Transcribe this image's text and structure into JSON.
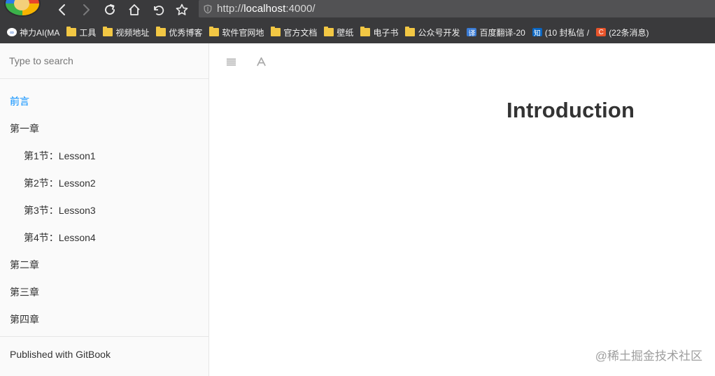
{
  "browser": {
    "url_prefix": "http://",
    "url_host": "localhost",
    "url_suffix": ":4000/",
    "bookmarks": [
      {
        "label": "神力AI(MA",
        "icon": "shenli-icon",
        "type": "site"
      },
      {
        "label": "工具",
        "icon": "folder-icon",
        "type": "folder"
      },
      {
        "label": "视频地址",
        "icon": "folder-icon",
        "type": "folder"
      },
      {
        "label": "优秀博客",
        "icon": "folder-icon",
        "type": "folder"
      },
      {
        "label": "软件官网地",
        "icon": "folder-icon",
        "type": "folder"
      },
      {
        "label": "官方文档",
        "icon": "folder-icon",
        "type": "folder"
      },
      {
        "label": "壁纸",
        "icon": "folder-icon",
        "type": "folder"
      },
      {
        "label": "电子书",
        "icon": "folder-icon",
        "type": "folder"
      },
      {
        "label": "公众号开发",
        "icon": "folder-icon",
        "type": "folder"
      },
      {
        "label": "百度翻译-20",
        "icon": "translate-icon",
        "type": "site",
        "glyph": "译",
        "color": "#3a7bd5"
      },
      {
        "label": "(10 封私信 /",
        "icon": "zhihu-icon",
        "type": "site",
        "glyph": "知",
        "color": "#0a66c2"
      },
      {
        "label": "(22条消息)",
        "icon": "csdn-icon",
        "type": "site",
        "glyph": "C",
        "color": "#e8542b"
      }
    ]
  },
  "sidebar": {
    "search_placeholder": "Type to search",
    "toc": [
      {
        "label": "前言",
        "level": 0,
        "active": true
      },
      {
        "label": "第一章",
        "level": 0,
        "active": false
      },
      {
        "label": "第1节：Lesson1",
        "level": 1,
        "active": false
      },
      {
        "label": "第2节：Lesson2",
        "level": 1,
        "active": false
      },
      {
        "label": "第3节：Lesson3",
        "level": 1,
        "active": false
      },
      {
        "label": "第4节：Lesson4",
        "level": 1,
        "active": false
      },
      {
        "label": "第二章",
        "level": 0,
        "active": false
      },
      {
        "label": "第三章",
        "level": 0,
        "active": false
      },
      {
        "label": "第四章",
        "level": 0,
        "active": false
      }
    ],
    "published": "Published with GitBook"
  },
  "content": {
    "toggle_icon": "hamburger-icon",
    "font_icon": "font-settings-icon",
    "title": "Introduction"
  },
  "watermark": "@稀土掘金技术社区",
  "colors": {
    "chrome": "#3a3a3c",
    "address_bar": "#525254",
    "active_link": "#008cff",
    "text": "#333333"
  }
}
